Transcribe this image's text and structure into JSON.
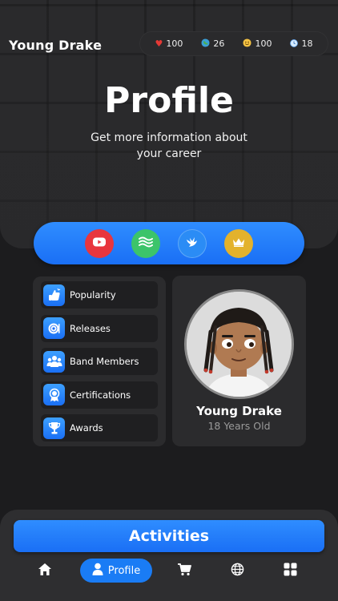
{
  "header": {
    "player_name": "Young Drake",
    "stats": [
      {
        "icon": "heart-icon",
        "value": "100",
        "color": "#e53935"
      },
      {
        "icon": "globe-icon",
        "value": "26",
        "color": "#3aa0d8"
      },
      {
        "icon": "smiley-icon",
        "value": "100",
        "color": "#f6c343"
      },
      {
        "icon": "clock-icon",
        "value": "18",
        "color": "#9ecbff"
      }
    ]
  },
  "page": {
    "title": "Profile",
    "subtitle": "Get more information about your career"
  },
  "categories": [
    {
      "icon": "youtube-icon",
      "color": "#e8363e"
    },
    {
      "icon": "waves-icon",
      "color": "#3cc46a"
    },
    {
      "icon": "bird-icon",
      "color": "#2b8cf5"
    },
    {
      "icon": "crown-icon",
      "color": "#e3b22c"
    }
  ],
  "menu": {
    "items": [
      {
        "label": "Popularity",
        "icon": "popularity-icon"
      },
      {
        "label": "Releases",
        "icon": "vinyl-record-icon"
      },
      {
        "label": "Band Members",
        "icon": "group-icon"
      },
      {
        "label": "Certifications",
        "icon": "medal-icon"
      },
      {
        "label": "Awards",
        "icon": "trophy-icon"
      }
    ]
  },
  "profile": {
    "name": "Young Drake",
    "age": "18 Years Old"
  },
  "actions": {
    "activities_label": "Activities"
  },
  "nav": {
    "profile_label": "Profile",
    "items": [
      "home-icon",
      "profile-icon",
      "cart-icon",
      "globe-icon",
      "grid-icon"
    ]
  },
  "colors": {
    "accent": "#1a7cf5",
    "background": "#1c1c1e",
    "card": "#2b2b2d"
  }
}
